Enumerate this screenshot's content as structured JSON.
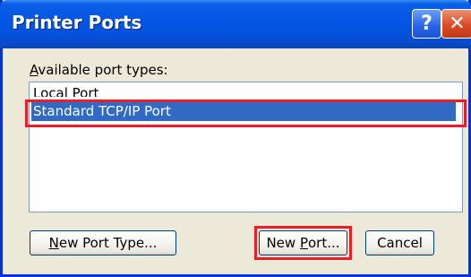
{
  "window": {
    "title": "Printer Ports",
    "help_glyph": "?",
    "close_glyph": "✕"
  },
  "dialog": {
    "label_accel": "A",
    "label_rest": "vailable port types:",
    "port_types": [
      {
        "label": "Local Port",
        "selected": false
      },
      {
        "label": "Standard TCP/IP Port",
        "selected": true
      }
    ]
  },
  "buttons": {
    "new_port_type": {
      "accel": "N",
      "rest": "ew Port Type..."
    },
    "new_port": {
      "before": "New ",
      "accel": "P",
      "rest": "ort..."
    },
    "cancel": "Cancel"
  },
  "colors": {
    "title_bar": "#0456e4",
    "dialog_bg": "#ece9d8",
    "selection": "#316ac5",
    "annotation": "#ee1c24"
  }
}
